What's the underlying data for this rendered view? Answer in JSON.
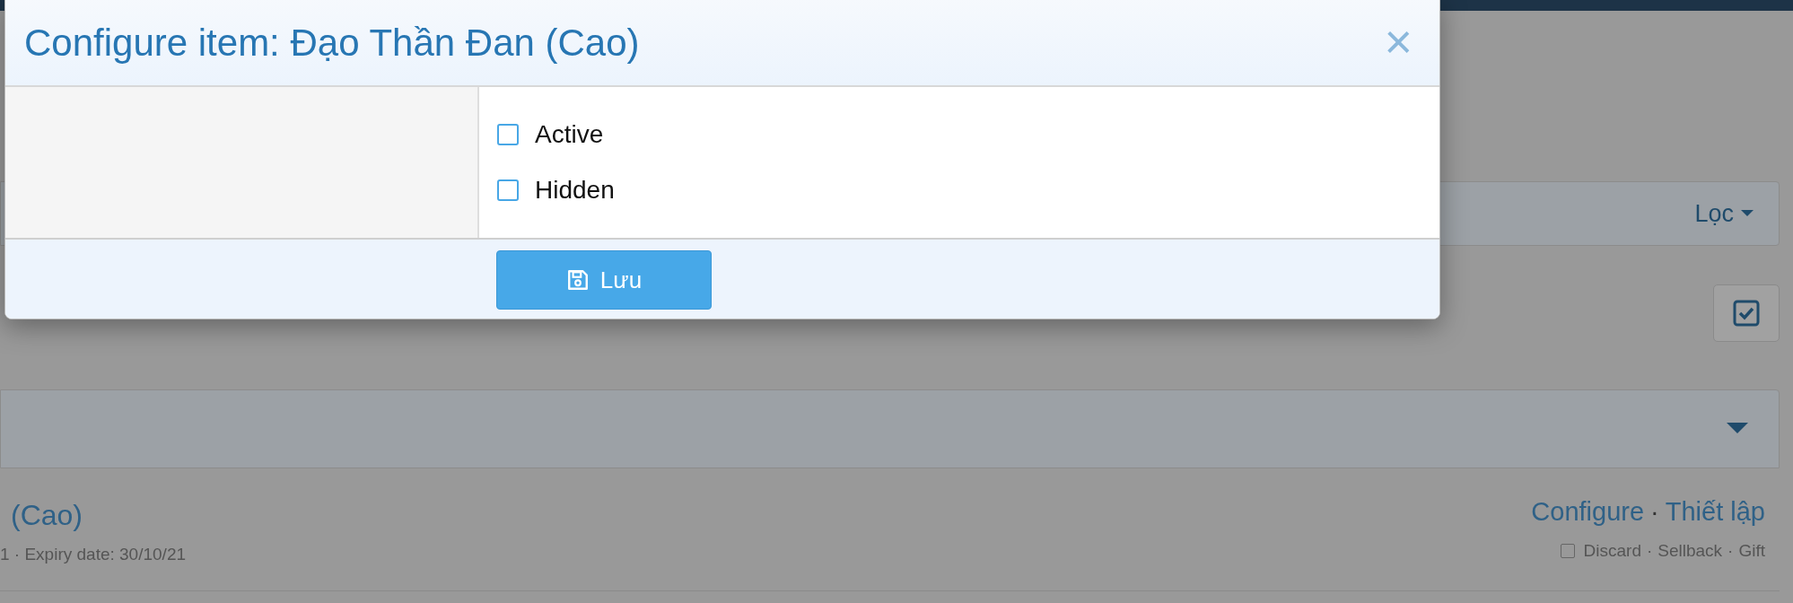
{
  "dialog": {
    "title": "Configure item: Đạo Thần Đan (Cao)",
    "close": "×",
    "options": [
      {
        "label": "Active",
        "checked": false
      },
      {
        "label": "Hidden",
        "checked": false
      }
    ],
    "save_button": "Lưu"
  },
  "background": {
    "filter_button": "Lọc",
    "item": {
      "name": "(Cao)",
      "meta": "1 · Expiry date: 30/10/21",
      "separator": "·",
      "links": [
        "Configure",
        "Thiết lập"
      ],
      "actions": [
        {
          "label": "Discard",
          "kind": "checkbox",
          "checked": false
        },
        {
          "label": "Sellback",
          "kind": "link"
        },
        {
          "label": "Gift",
          "kind": "link"
        }
      ]
    }
  }
}
